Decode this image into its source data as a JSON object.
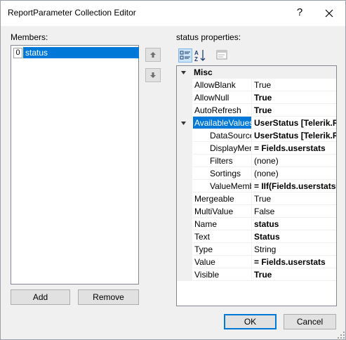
{
  "window": {
    "title": "ReportParameter Collection Editor",
    "help_glyph": "?"
  },
  "members": {
    "label": "Members:",
    "items": [
      {
        "index": "0",
        "name": "status"
      }
    ]
  },
  "properties": {
    "label": "status properties:",
    "category": "Misc",
    "rows": [
      {
        "name": "AllowBlank",
        "value": "True",
        "bold": false
      },
      {
        "name": "AllowNull",
        "value": "True",
        "bold": true
      },
      {
        "name": "AutoRefresh",
        "value": "True",
        "bold": true
      },
      {
        "name": "AvailableValues",
        "value": "UserStatus [Telerik.Repo",
        "bold": true,
        "selected": true,
        "expanded": true
      },
      {
        "name": "DataSource",
        "value": "UserStatus [Telerik.Repo",
        "bold": true,
        "child": true
      },
      {
        "name": "DisplayMem",
        "value": "= Fields.userstats",
        "bold": true,
        "child": true
      },
      {
        "name": "Filters",
        "value": "(none)",
        "bold": false,
        "child": true
      },
      {
        "name": "Sortings",
        "value": "(none)",
        "bold": false,
        "child": true
      },
      {
        "name": "ValueMemb",
        "value": "= IIf(Fields.userstats='A",
        "bold": true,
        "child": true
      },
      {
        "name": "Mergeable",
        "value": "True",
        "bold": false
      },
      {
        "name": "MultiValue",
        "value": "False",
        "bold": false
      },
      {
        "name": "Name",
        "value": "status",
        "bold": true
      },
      {
        "name": "Text",
        "value": "Status",
        "bold": true
      },
      {
        "name": "Type",
        "value": "String",
        "bold": false
      },
      {
        "name": "Value",
        "value": "= Fields.userstats",
        "bold": true
      },
      {
        "name": "Visible",
        "value": "True",
        "bold": true
      }
    ]
  },
  "buttons": {
    "add": "Add",
    "remove": "Remove",
    "ok": "OK",
    "cancel": "Cancel"
  },
  "colors": {
    "selection": "#0078d7",
    "background": "#f0f0f0"
  }
}
